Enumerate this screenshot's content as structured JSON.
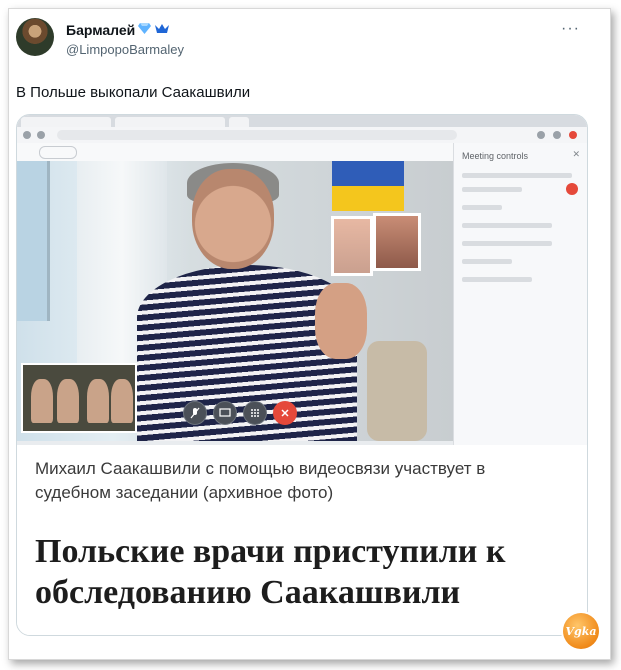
{
  "tweet": {
    "display_name": "Бармалей",
    "badge_icons": [
      "diamond-icon",
      "crown-icon"
    ],
    "handle": "@LimpopoBarmaley",
    "more_label": "···",
    "text": "В Польше выкопали Саакашвили"
  },
  "card": {
    "caption": "Михаил Саакашвили с помощью видеосвязи участвует в судебном заседании (архивное фото)",
    "headline": "Польские врачи приступили к обследованию Саакашвили"
  },
  "screenshot_in_photo": {
    "panel_title": "Meeting controls",
    "panel_close": "✕",
    "flag_colors": [
      "#2f5db8",
      "#f4c61d"
    ],
    "end_call_color": "#e5493a"
  },
  "watermark": {
    "icon": "logo-icon",
    "text": "Vgka"
  }
}
